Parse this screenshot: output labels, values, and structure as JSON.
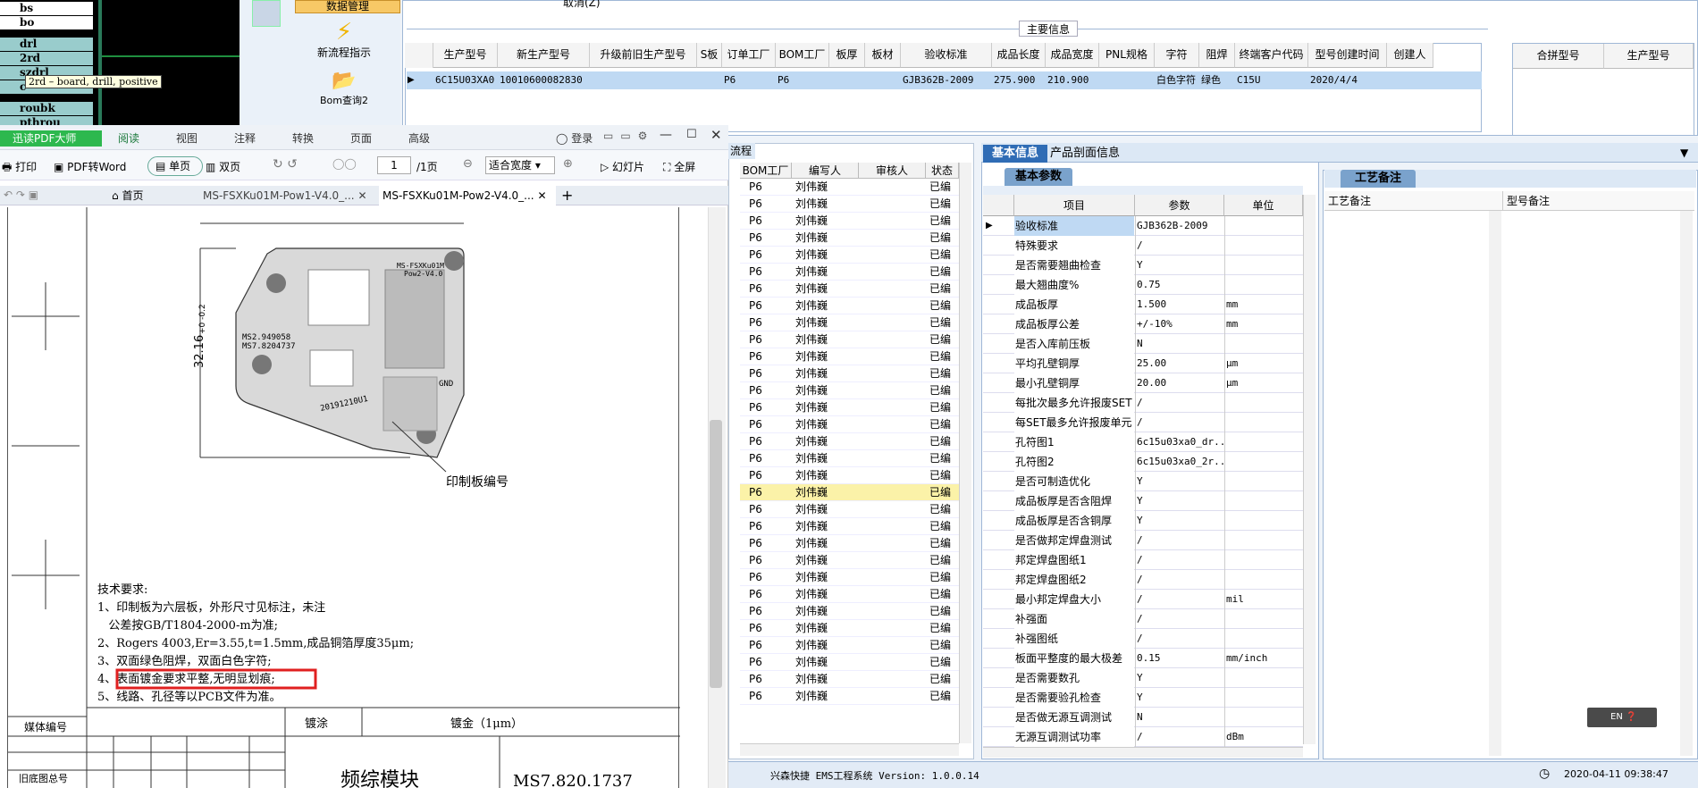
{
  "cam": {
    "layers": [
      "bs",
      "bo",
      "drl",
      "2rd",
      "szdrl",
      "c",
      "roubk",
      "pthrou"
    ],
    "tooltip": "2rd – board, drill, positive"
  },
  "ribbon": {
    "tab": "数据管理",
    "flow": "新流程指示",
    "bom": "Bom查询2"
  },
  "top": {
    "cancel": "取消(Z)",
    "main_info": "主要信息",
    "headers": [
      "生产型号",
      "新生产型号",
      "升级前旧生产型号",
      "S板",
      "订单工厂",
      "BOM工厂",
      "板厚",
      "板材",
      "验收标准",
      "成品长度",
      "成品宽度",
      "PNL规格",
      "字符",
      "阻焊",
      "终端客户代码",
      "型号创建时间",
      "创建人"
    ],
    "row": [
      "6C15U03XA0",
      "10010600082830",
      "",
      "",
      "P6",
      "P6",
      "",
      "",
      "GJB362B-2009",
      "275.900",
      "210.900",
      "",
      "白色字符",
      "绿色",
      "C15U",
      "2020/4/4",
      ""
    ],
    "merge_headers": [
      "合拼型号",
      "生产型号"
    ]
  },
  "pdf": {
    "app": "迅读PDF大师",
    "menu": [
      "阅读",
      "视图",
      "注释",
      "转换",
      "页面",
      "高级"
    ],
    "login": "登录",
    "tools": {
      "print": "打印",
      "topdf": "PDF转Word",
      "single": "单页",
      "double": "双页",
      "page": "1",
      "pages": "/1页",
      "fit": "适合宽度",
      "slide": "幻灯片",
      "full": "全屏"
    },
    "tabs": [
      "首页",
      "MS-FSXKu01M-Pow1-V4.0_...",
      "MS-FSXKu01M-Pow2-V4.0_..."
    ],
    "drawing": {
      "dim": "32.16",
      "dim_tol": "+0\n-0.2",
      "pcb_title": "MS-FSXKu01M",
      "pcb_ver": "Pow2-V4.0",
      "label_a": "MS2.949058",
      "label_b": "MS7.8204737",
      "label_c": "20191210U1",
      "label_gnd": "GND",
      "label_pn": "印制板编号",
      "req_title": "技术要求:",
      "req": [
        "1、印制板为六层板，外形尺寸见标注，未注",
        "   公差按GB/T1804-2000-m为准;",
        "2、Rogers 4003,Er=3.55,t=1.5mm,成品铜箔厚度35μm;",
        "3、双面绿色阻焊，双面白色字符;",
        "4、表面镀金要求平整,无明显划痕;",
        "5、线路、孔径等以PCB文件为准。"
      ],
      "table": {
        "media": "媒体编号",
        "old": "旧底图总号",
        "plating": "镀涂",
        "gold": "镀金（1μm）",
        "module": "频综模块",
        "code": "MS7.820.1737"
      }
    }
  },
  "mid": {
    "flow": "流程",
    "headers": [
      "BOM工厂",
      "编写人",
      "审核人",
      "状态"
    ],
    "factory": "P6",
    "writer": "刘伟巍",
    "status": "已编"
  },
  "basic": {
    "tab1": "基本信息",
    "tab2": "产品剖面信息",
    "sub": "基本参数",
    "headers": [
      "项目",
      "参数",
      "单位"
    ],
    "rows": [
      [
        "验收标准",
        "GJB362B-2009",
        ""
      ],
      [
        "特殊要求",
        "/",
        ""
      ],
      [
        "是否需要翘曲检查",
        "Y",
        ""
      ],
      [
        "最大翘曲度%",
        "0.75",
        ""
      ],
      [
        "成品板厚",
        "1.500",
        "mm"
      ],
      [
        "成品板厚公差",
        "+/-10%",
        "mm"
      ],
      [
        "是否入库前压板",
        "N",
        ""
      ],
      [
        "平均孔壁铜厚",
        "25.00",
        "μm"
      ],
      [
        "最小孔壁铜厚",
        "20.00",
        "μm"
      ],
      [
        "每批次最多允许报废SET",
        "/",
        ""
      ],
      [
        "每SET最多允许报废单元",
        "/",
        ""
      ],
      [
        "孔符图1",
        "6c15u03xa0_dr...",
        ""
      ],
      [
        "孔符图2",
        "6c15u03xa0_2r...",
        ""
      ],
      [
        "是否可制造优化",
        "Y",
        ""
      ],
      [
        "成品板厚是否含阻焊",
        "Y",
        ""
      ],
      [
        "成品板厚是否含铜厚",
        "Y",
        ""
      ],
      [
        "是否做邦定焊盘测试",
        "/",
        ""
      ],
      [
        "邦定焊盘图纸1",
        "/",
        ""
      ],
      [
        "邦定焊盘图纸2",
        "/",
        ""
      ],
      [
        "最小邦定焊盘大小",
        "/",
        "mil"
      ],
      [
        "补强面",
        "/",
        ""
      ],
      [
        "补强图纸",
        "/",
        ""
      ],
      [
        "板面平整度的最大极差",
        "0.15",
        "mm/inch"
      ],
      [
        "是否需要数孔",
        "Y",
        ""
      ],
      [
        "是否需要验孔检查",
        "Y",
        ""
      ],
      [
        "是否做无源互调测试",
        "N",
        ""
      ],
      [
        "无源互调测试功率",
        "/",
        "dBm"
      ]
    ]
  },
  "craft": {
    "tab": "工艺备注",
    "h1": "工艺备注",
    "h2": "型号备注",
    "ime": "EN"
  },
  "status": {
    "text": "兴森快捷 EMS工程系统 Version: 1.0.0.14",
    "time": "2020-04-11 09:38:47"
  }
}
